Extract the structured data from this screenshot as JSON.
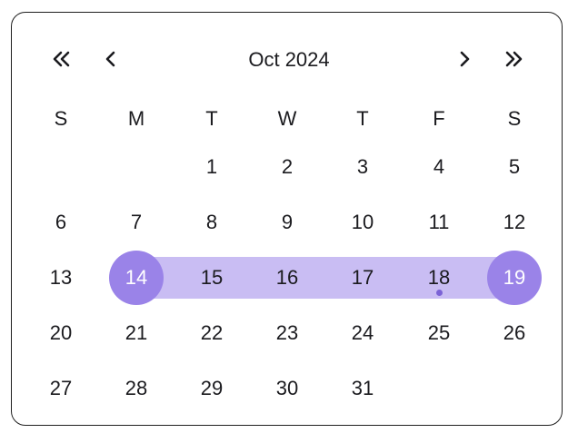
{
  "calendar": {
    "month_label": "Oct 2024",
    "nav": {
      "prev_year_icon": "double-chevron-left-icon",
      "prev_month_icon": "chevron-left-icon",
      "next_month_icon": "chevron-right-icon",
      "next_year_icon": "double-chevron-right-icon"
    },
    "weekdays": [
      "S",
      "M",
      "T",
      "W",
      "T",
      "F",
      "S"
    ],
    "weeks": [
      [
        "",
        "",
        "1",
        "2",
        "3",
        "4",
        "5"
      ],
      [
        "6",
        "7",
        "8",
        "9",
        "10",
        "11",
        "12"
      ],
      [
        "13",
        "14",
        "15",
        "16",
        "17",
        "18",
        "19"
      ],
      [
        "20",
        "21",
        "22",
        "23",
        "24",
        "25",
        "26"
      ],
      [
        "27",
        "28",
        "29",
        "30",
        "31",
        "",
        ""
      ]
    ],
    "range_start": "14",
    "range_end": "19",
    "today": "18",
    "colors": {
      "range_endpoint": "#9a83e8",
      "range_band": "#c9bdf3",
      "today_marker": "#7b63d6",
      "border": "#1f1f1f"
    }
  }
}
